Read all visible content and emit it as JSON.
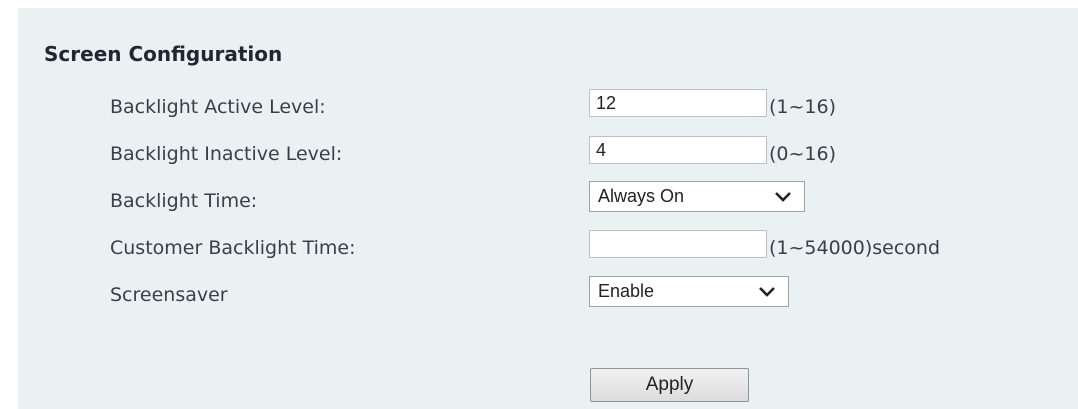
{
  "section": {
    "title": "Screen Configuration"
  },
  "fields": {
    "backlight_active": {
      "label": "Backlight Active Level:",
      "value": "12",
      "range": "(1~16)"
    },
    "backlight_inactive": {
      "label": "Backlight Inactive Level:",
      "value": "4",
      "range": "(0~16)"
    },
    "backlight_time": {
      "label": "Backlight Time:",
      "selected": "Always On"
    },
    "customer_backlight_time": {
      "label": "Customer Backlight Time:",
      "value": "",
      "range": "(1~54000)second"
    },
    "screensaver": {
      "label": "Screensaver",
      "selected": "Enable"
    }
  },
  "actions": {
    "apply_label": "Apply"
  },
  "icons": {
    "dropdown": "chevron-down-icon"
  }
}
